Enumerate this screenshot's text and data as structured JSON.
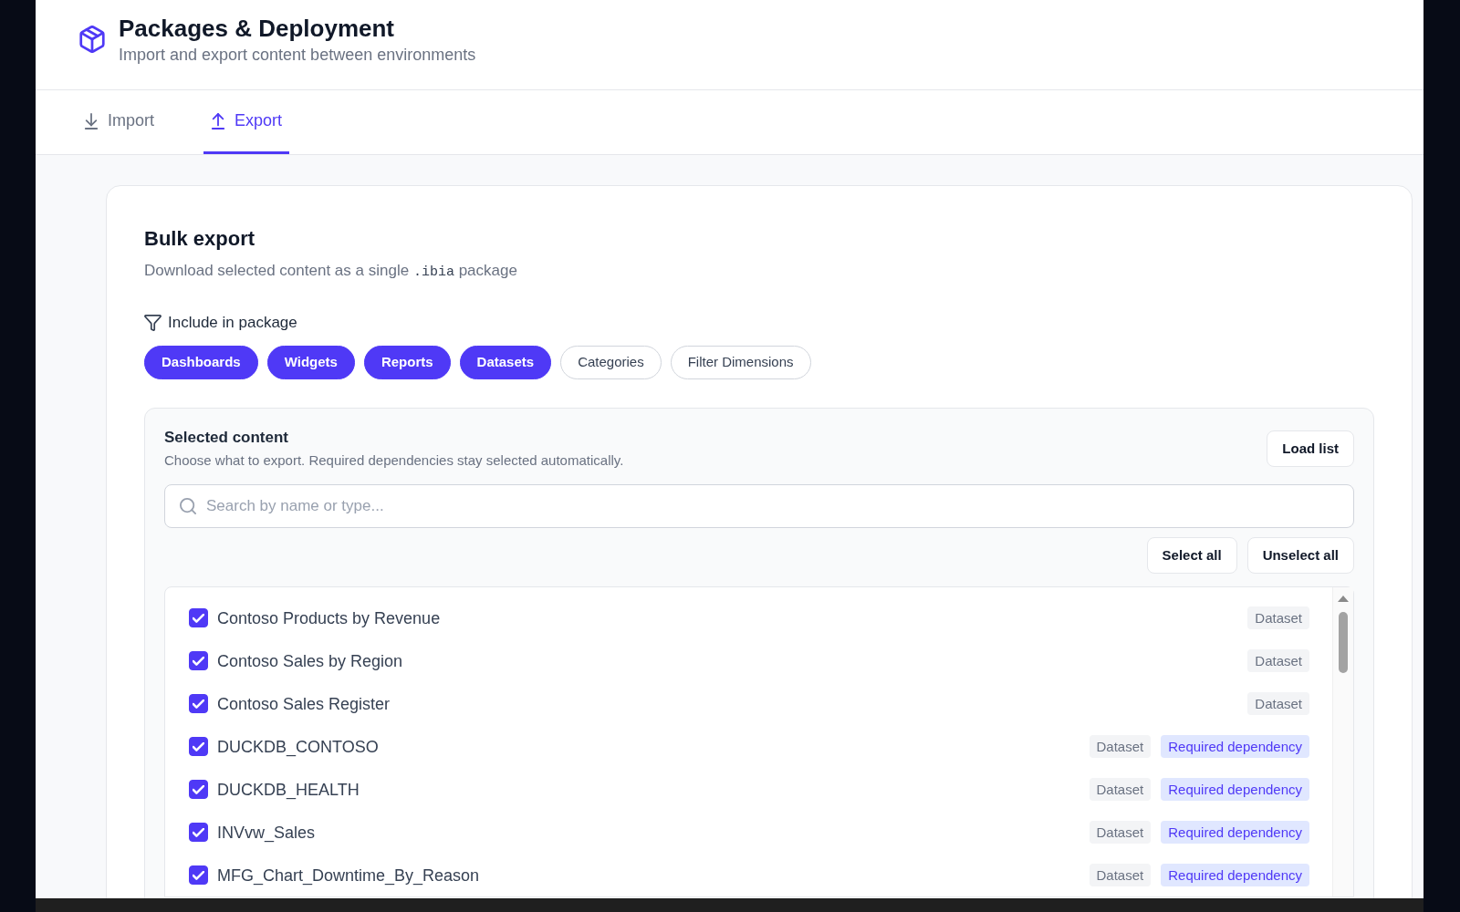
{
  "header": {
    "title": "Packages & Deployment",
    "subtitle": "Import and export content between environments"
  },
  "tabs": [
    {
      "label": "Import",
      "kind": "import",
      "selected": false
    },
    {
      "label": "Export",
      "kind": "export",
      "selected": true
    }
  ],
  "bulk_export": {
    "title": "Bulk export",
    "description": {
      "before": "Download selected content as a single",
      "code": ".ibia",
      "after": "package"
    },
    "include": {
      "label": "Include in package",
      "options": [
        {
          "label": "Dashboards",
          "selected": true
        },
        {
          "label": "Widgets",
          "selected": true
        },
        {
          "label": "Reports",
          "selected": true
        },
        {
          "label": "Datasets",
          "selected": true
        },
        {
          "label": "Categories",
          "selected": false
        },
        {
          "label": "Filter Dimensions",
          "selected": false
        }
      ]
    },
    "selected_content": {
      "title": "Selected content",
      "hint": "Choose what to export. Required dependencies stay selected automatically.",
      "load_button": "Load list",
      "search": {
        "placeholder": "Search by name or type..."
      },
      "select_all": "Select all",
      "unselect_all": "Unselect all",
      "items": [
        {
          "name": "Contoso Products by Revenue",
          "checked": true,
          "tags": [
            {
              "label": "Dataset",
              "kind": "type"
            }
          ]
        },
        {
          "name": "Contoso Sales by Region",
          "checked": true,
          "tags": [
            {
              "label": "Dataset",
              "kind": "type"
            }
          ]
        },
        {
          "name": "Contoso Sales Register",
          "checked": true,
          "tags": [
            {
              "label": "Dataset",
              "kind": "type"
            }
          ]
        },
        {
          "name": "DUCKDB_CONTOSO",
          "checked": true,
          "tags": [
            {
              "label": "Dataset",
              "kind": "type"
            },
            {
              "label": "Required dependency",
              "kind": "dependency"
            }
          ]
        },
        {
          "name": "DUCKDB_HEALTH",
          "checked": true,
          "tags": [
            {
              "label": "Dataset",
              "kind": "type"
            },
            {
              "label": "Required dependency",
              "kind": "dependency"
            }
          ]
        },
        {
          "name": "INVvw_Sales",
          "checked": true,
          "tags": [
            {
              "label": "Dataset",
              "kind": "type"
            },
            {
              "label": "Required dependency",
              "kind": "dependency"
            }
          ]
        },
        {
          "name": "MFG_Chart_Downtime_By_Reason",
          "checked": true,
          "tags": [
            {
              "label": "Dataset",
              "kind": "type"
            },
            {
              "label": "Required dependency",
              "kind": "dependency"
            }
          ]
        }
      ]
    }
  }
}
